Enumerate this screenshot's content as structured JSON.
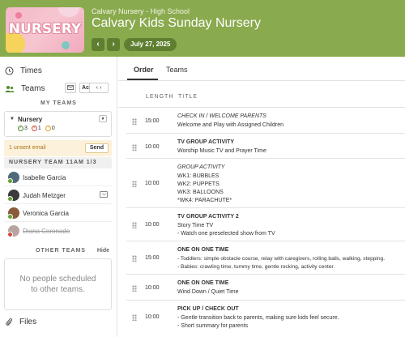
{
  "header": {
    "logo_text": "NURSERY",
    "org": "Calvary Nursery - High School",
    "title": "Calvary Kids Sunday Nursery",
    "prev_icon": "chevron-left-icon",
    "next_icon": "chevron-right-icon",
    "prev_glyph": "‹",
    "next_glyph": "›",
    "date": "July 27, 2025",
    "color": "#8aaa4e",
    "accent": "#5f7f30"
  },
  "sidebar": {
    "times_label": "Times",
    "teams_label": "Teams",
    "ac_label": "Ac",
    "my_teams": "MY TEAMS",
    "team": {
      "name": "Nursery",
      "confirmed": "3",
      "declined": "1",
      "pending": "0"
    },
    "unsent_email": "1 unsent email",
    "send_label": "Send",
    "team_bar": "NURSERY TEAM 11AM 1/3",
    "people": [
      {
        "name": "Isabelle Garcia",
        "avatar_color": "#4f6a7a"
      },
      {
        "name": "Judah Metzger",
        "avatar_color": "#3b3b3b"
      },
      {
        "name": "Veronica Garcia",
        "avatar_color": "#8a5a3a"
      },
      {
        "name": "Diana Coronado",
        "avatar_color": "#b9a5a0"
      }
    ],
    "other_teams": "OTHER TEAMS",
    "hide_label": "Hide",
    "no_people_line1": "No people scheduled",
    "no_people_line2": "to other teams.",
    "files_label": "Files"
  },
  "main": {
    "tabs": [
      "Order",
      "Teams"
    ],
    "col_length": "LENGTH",
    "col_title": "TITLE",
    "items": [
      {
        "length": "15:00",
        "title": "CHECK IN / WELCOME PARENTS",
        "detail": "Welcome and Play with Assigned Children"
      },
      {
        "length": "10:00",
        "title": "TV GROUP ACTIVITY",
        "detail": "Worship Music TV and Prayer Time"
      },
      {
        "length": "10:00",
        "title": "GROUP ACTIVITY",
        "lines": [
          "WK1: BUBBLES",
          "WK2: PUPPETS",
          "WK3: BALLOONS",
          "*WK4: PARACHUTE*"
        ]
      },
      {
        "length": "10:00",
        "title": "TV GROUP ACTIVITY 2",
        "lines": [
          "Story Time TV",
          "- Watch one preselected show from TV"
        ]
      },
      {
        "length": "15:00",
        "title": "ONE ON ONE TIME",
        "lines": [
          "- Toddlers: simple obstacle course, relay with caregivers, rolling balls, walking, stepping.",
          "- Babies: crawling time, tummy time, gentle rocking, activity center."
        ]
      },
      {
        "length": "10:00",
        "title": "ONE ON ONE TIME",
        "detail": "Wind Down / Quiet Time"
      },
      {
        "length": "10:00",
        "title": "PICK UP / CHECK OUT",
        "lines": [
          "- Gentle transition back to parents, making sure kids feel secure.",
          "- Short summary for parents"
        ]
      }
    ]
  }
}
